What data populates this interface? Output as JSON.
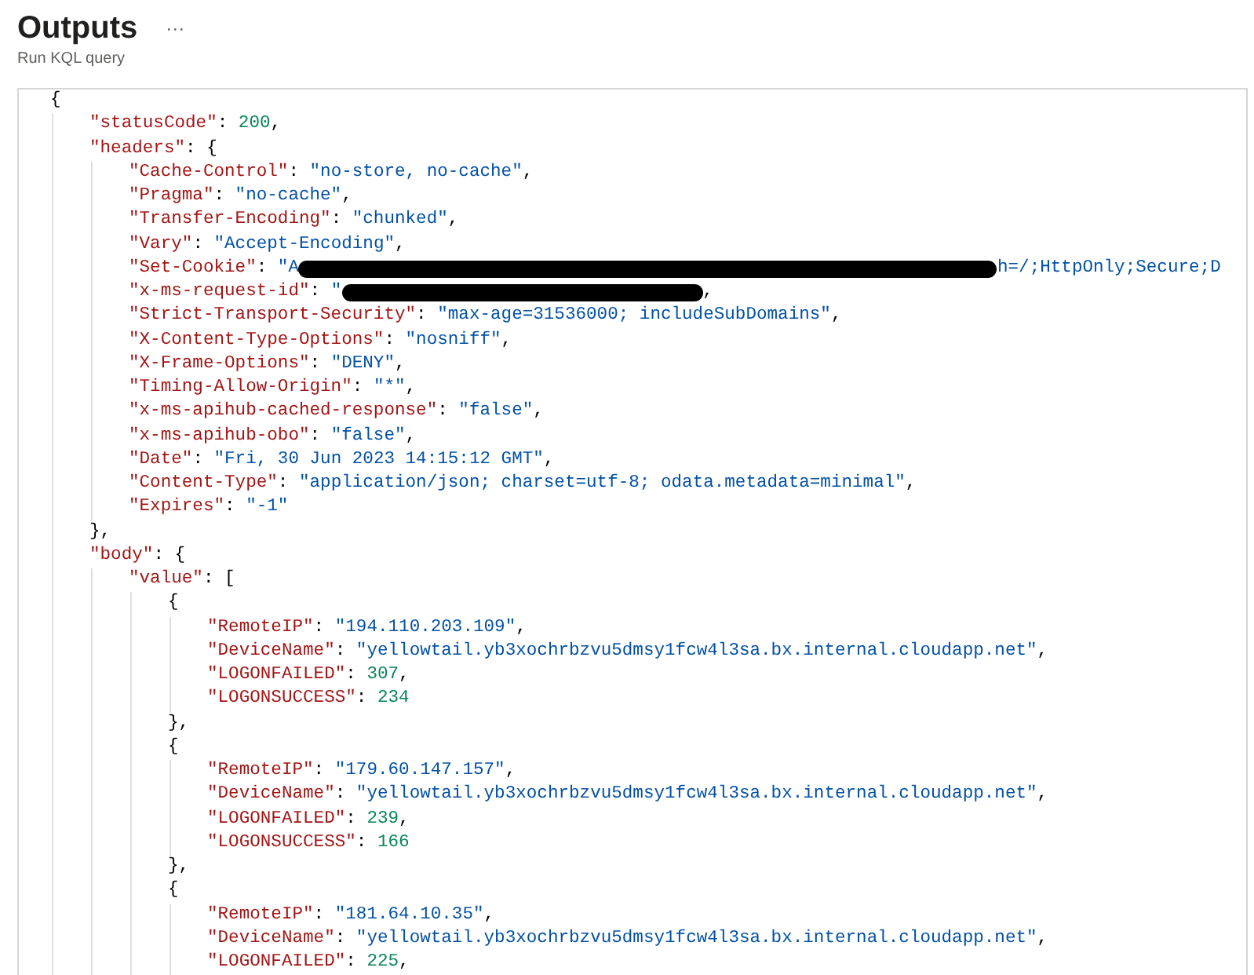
{
  "header": {
    "title": "Outputs",
    "more": "···",
    "subtitle": "Run KQL query"
  },
  "code": [
    {
      "kind": "block",
      "open": "{",
      "children": [
        {
          "kind": "number",
          "key": "\"statusCode\"",
          "colon": ":",
          "value": "200",
          "end": ","
        },
        {
          "kind": "block",
          "key": "\"headers\"",
          "colon": ":",
          "open": "{",
          "close": "}",
          "end": ",",
          "children": [
            {
              "kind": "string",
              "key": "\"Cache-Control\"",
              "colon": ":",
              "value": "\"no-store, no-cache\"",
              "end": ","
            },
            {
              "kind": "string",
              "key": "\"Pragma\"",
              "colon": ":",
              "value": "\"no-cache\"",
              "end": ","
            },
            {
              "kind": "string",
              "key": "\"Transfer-Encoding\"",
              "colon": ":",
              "value": "\"chunked\"",
              "end": ","
            },
            {
              "kind": "string",
              "key": "\"Vary\"",
              "colon": ":",
              "value": "\"Accept-Encoding\"",
              "end": ","
            },
            {
              "kind": "redacted",
              "key": "\"Set-Cookie\"",
              "colon": ":",
              "value_start": "\"A",
              "value_end": "h=/;HttpOnly;Secure;D"
            },
            {
              "kind": "redacted",
              "key": "\"x-ms-request-id\"",
              "colon": ":",
              "value_start": "\"",
              "end": ","
            },
            {
              "kind": "string",
              "key": "\"Strict-Transport-Security\"",
              "colon": ":",
              "value": "\"max-age=31536000; includeSubDomains\"",
              "end": ","
            },
            {
              "kind": "string",
              "key": "\"X-Content-Type-Options\"",
              "colon": ":",
              "value": "\"nosniff\"",
              "end": ","
            },
            {
              "kind": "string",
              "key": "\"X-Frame-Options\"",
              "colon": ":",
              "value": "\"DENY\"",
              "end": ","
            },
            {
              "kind": "string",
              "key": "\"Timing-Allow-Origin\"",
              "colon": ":",
              "value": "\"*\"",
              "end": ","
            },
            {
              "kind": "string",
              "key": "\"x-ms-apihub-cached-response\"",
              "colon": ":",
              "value": "\"false\"",
              "end": ","
            },
            {
              "kind": "string",
              "key": "\"x-ms-apihub-obo\"",
              "colon": ":",
              "value": "\"false\"",
              "end": ","
            },
            {
              "kind": "string",
              "key": "\"Date\"",
              "colon": ":",
              "value": "\"Fri, 30 Jun 2023 14:15:12 GMT\"",
              "end": ","
            },
            {
              "kind": "string",
              "key": "\"Content-Type\"",
              "colon": ":",
              "value": "\"application/json; charset=utf-8; odata.metadata=minimal\"",
              "end": ","
            },
            {
              "kind": "string",
              "key": "\"Expires\"",
              "colon": ":",
              "value": "\"-1\""
            }
          ]
        },
        {
          "kind": "block",
          "key": "\"body\"",
          "colon": ":",
          "open": "{",
          "children": [
            {
              "kind": "block",
              "key": "\"value\"",
              "colon": ":",
              "open": "[",
              "children": [
                {
                  "kind": "block",
                  "open": "{",
                  "close": "}",
                  "end": ",",
                  "children": [
                    {
                      "kind": "string",
                      "key": "\"RemoteIP\"",
                      "colon": ":",
                      "value": "\"194.110.203.109\"",
                      "end": ","
                    },
                    {
                      "kind": "string",
                      "key": "\"DeviceName\"",
                      "colon": ":",
                      "value": "\"yellowtail.yb3xochrbzvu5dmsy1fcw4l3sa.bx.internal.cloudapp.net\"",
                      "end": ","
                    },
                    {
                      "kind": "number",
                      "key": "\"LOGONFAILED\"",
                      "colon": ":",
                      "value": "307",
                      "end": ","
                    },
                    {
                      "kind": "number",
                      "key": "\"LOGONSUCCESS\"",
                      "colon": ":",
                      "value": "234"
                    }
                  ]
                },
                {
                  "kind": "block",
                  "open": "{",
                  "close": "}",
                  "end": ",",
                  "children": [
                    {
                      "kind": "string",
                      "key": "\"RemoteIP\"",
                      "colon": ":",
                      "value": "\"179.60.147.157\"",
                      "end": ","
                    },
                    {
                      "kind": "string",
                      "key": "\"DeviceName\"",
                      "colon": ":",
                      "value": "\"yellowtail.yb3xochrbzvu5dmsy1fcw4l3sa.bx.internal.cloudapp.net\"",
                      "end": ","
                    },
                    {
                      "kind": "number",
                      "key": "\"LOGONFAILED\"",
                      "colon": ":",
                      "value": "239",
                      "end": ","
                    },
                    {
                      "kind": "number",
                      "key": "\"LOGONSUCCESS\"",
                      "colon": ":",
                      "value": "166"
                    }
                  ]
                },
                {
                  "kind": "block",
                  "open": "{",
                  "children": [
                    {
                      "kind": "string",
                      "key": "\"RemoteIP\"",
                      "colon": ":",
                      "value": "\"181.64.10.35\"",
                      "end": ","
                    },
                    {
                      "kind": "string",
                      "key": "\"DeviceName\"",
                      "colon": ":",
                      "value": "\"yellowtail.yb3xochrbzvu5dmsy1fcw4l3sa.bx.internal.cloudapp.net\"",
                      "end": ","
                    },
                    {
                      "kind": "number",
                      "key": "\"LOGONFAILED\"",
                      "colon": ":",
                      "value": "225",
                      "end": ","
                    }
                  ]
                }
              ]
            }
          ]
        }
      ]
    }
  ]
}
